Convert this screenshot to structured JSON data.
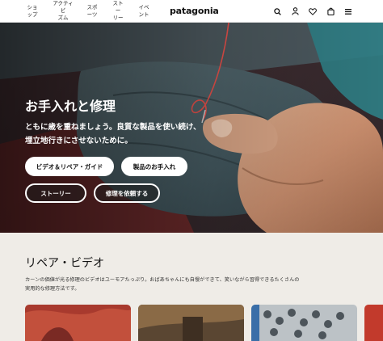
{
  "header": {
    "nav": [
      {
        "label": "ショ\nップ"
      },
      {
        "label": "アクティビ\nズム"
      },
      {
        "label": "スポ\nーツ"
      },
      {
        "label": "ストー\nリー"
      },
      {
        "label": "イベ\nント"
      }
    ],
    "logo": "patagonia",
    "icons": [
      "search-icon",
      "account-icon",
      "heart-icon",
      "cart-icon",
      "menu-icon"
    ]
  },
  "hero": {
    "title": "お手入れと修理",
    "description": "ともに歳を重ねましょう。良質な製品を使い続け、埋立地行きにさせないために。",
    "buttons": {
      "repair_video": "ビデオ＆リペア・ガイド",
      "care": "製品のお手入れ",
      "stories": "ストーリー",
      "request_repair": "修理を依頼する"
    }
  },
  "videos": {
    "title": "リペア・ビデオ",
    "description": "カーンの価値が光る修理のビデオはユーモアたっぷり。おばあちゃんにも自慢ができて、笑いながら習得できるたくさんの実用的な修理方法です。"
  },
  "colors": {
    "thread": "#e8504a",
    "fabric": "#4a5d63",
    "section_bg": "#efece7"
  }
}
